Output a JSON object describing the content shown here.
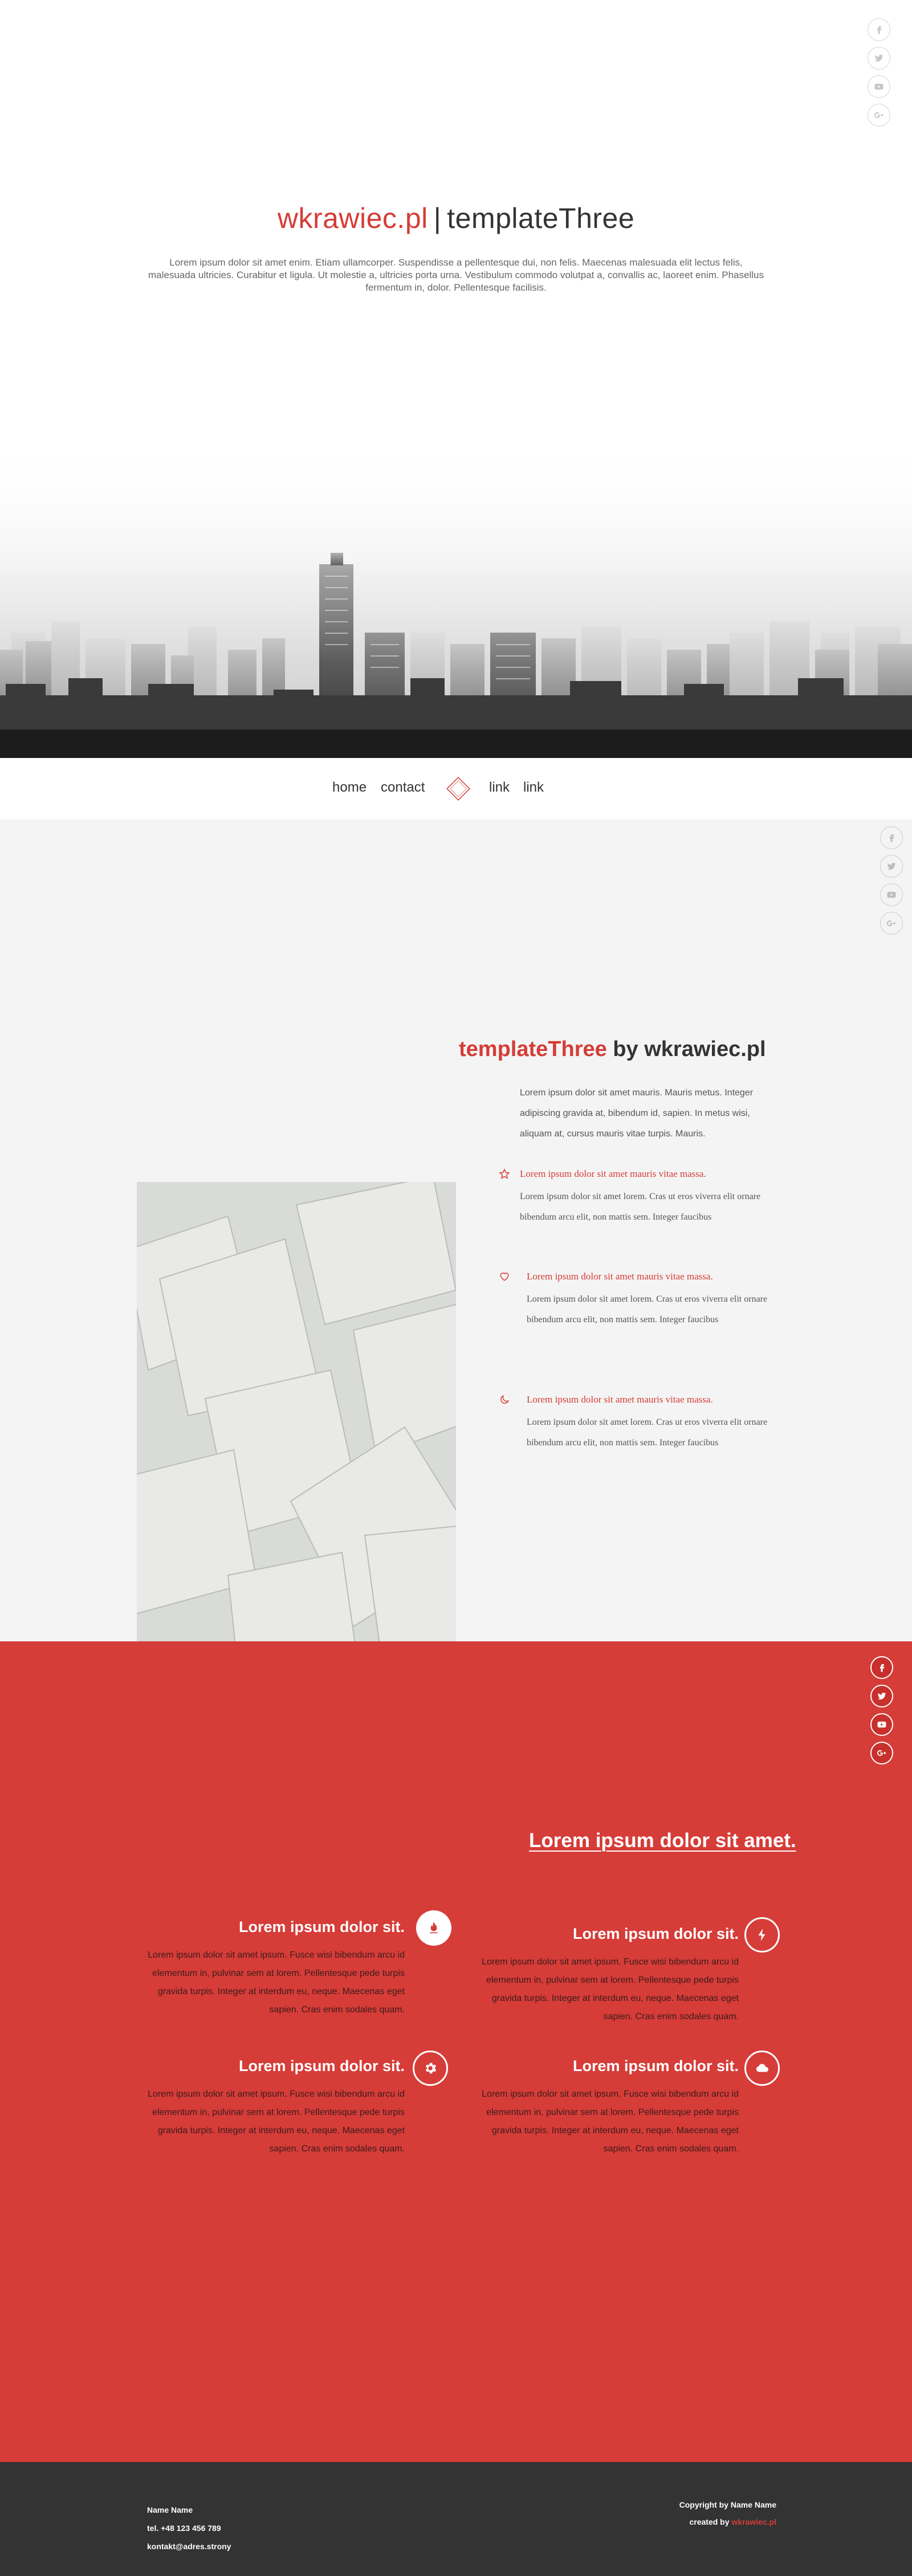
{
  "hero": {
    "brand": "wkrawiec.pl",
    "separator": "|",
    "template_name": "templateThree",
    "lead": "Lorem ipsum dolor sit amet enim. Etiam ullamcorper. Suspendisse a pellentesque dui, non felis. Maecenas malesuada elit lectus felis, malesuada ultricies. Curabitur et ligula. Ut molestie a, ultricies porta urna. Vestibulum commodo volutpat a, convallis ac, laoreet enim. Phasellus fermentum in, dolor. Pellentesque facilisis.",
    "social_icons": [
      "facebook-icon",
      "twitter-icon",
      "youtube-icon",
      "google-plus-icon"
    ]
  },
  "nav": {
    "items": [
      "home",
      "contact",
      "link",
      "link"
    ],
    "logo_icon": "diamond-logo-icon"
  },
  "about": {
    "heading_highlight": "templateThree",
    "heading_rest": " by wkrawiec.pl",
    "intro": "Lorem ipsum dolor sit amet mauris. Mauris metus. Integer adipiscing gravida at, bibendum id, sapien. In metus wisi, aliquam at, cursus mauris vitae turpis. Mauris.",
    "features": [
      {
        "icon": "star-icon",
        "title": "Lorem ipsum dolor sit amet mauris vitae massa.",
        "text": "Lorem ipsum dolor sit amet lorem. Cras ut eros viverra elit ornare bibendum arcu elit, non mattis sem. Integer faucibus"
      },
      {
        "icon": "heart-icon",
        "title": "Lorem ipsum dolor sit amet mauris vitae massa.",
        "text": "Lorem ipsum dolor sit amet lorem. Cras ut eros viverra elit ornare bibendum arcu elit, non mattis sem. Integer faucibus"
      },
      {
        "icon": "moon-icon",
        "title": "Lorem ipsum dolor sit amet mauris vitae massa.",
        "text": "Lorem ipsum dolor sit amet lorem. Cras ut eros viverra elit ornare bibendum arcu elit, non mattis sem. Integer faucibus"
      }
    ],
    "social_icons": [
      "facebook-icon",
      "twitter-icon",
      "youtube-icon",
      "google-plus-icon"
    ]
  },
  "services": {
    "title": "Lorem ipsum dolor sit amet.",
    "items": [
      {
        "icon": "fire-icon",
        "title": "Lorem ipsum dolor sit.",
        "text": "Lorem ipsum dolor sit amet ipsum. Fusce wisi bibendum arcu id elementum in, pulvinar sem at lorem. Pellentesque pede turpis gravida turpis. Integer at interdum eu, neque. Maecenas eget sapien. Cras enim sodales quam."
      },
      {
        "icon": "lightning-icon",
        "title": "Lorem ipsum dolor sit.",
        "text": "Lorem ipsum dolor sit amet ipsum. Fusce wisi bibendum arcu id elementum in, pulvinar sem at lorem. Pellentesque pede turpis gravida turpis. Integer at interdum eu, neque. Maecenas eget sapien. Cras enim sodales quam."
      },
      {
        "icon": "gear-icon",
        "title": "Lorem ipsum dolor sit.",
        "text": "Lorem ipsum dolor sit amet ipsum. Fusce wisi bibendum arcu id elementum in, pulvinar sem at lorem. Pellentesque pede turpis gravida turpis. Integer at interdum eu, neque. Maecenas eget sapien. Cras enim sodales quam."
      },
      {
        "icon": "cloud-icon",
        "title": "Lorem ipsum dolor sit.",
        "text": "Lorem ipsum dolor sit amet ipsum. Fusce wisi bibendum arcu id elementum in, pulvinar sem at lorem. Pellentesque pede turpis gravida turpis. Integer at interdum eu, neque. Maecenas eget sapien. Cras enim sodales quam."
      }
    ],
    "social_icons": [
      "facebook-icon",
      "twitter-icon",
      "youtube-icon",
      "google-plus-icon"
    ]
  },
  "footer": {
    "name": "Name Name",
    "phone": "tel. +48 123 456 789",
    "email": "kontakt@adres.strony",
    "copyright": "Copyright by Name Name",
    "created_by": "created by ",
    "creator": "wkrawiec.pl"
  },
  "colors": {
    "accent": "#d53c37",
    "services_bg": "#d63c38",
    "about_bg": "#f4f4f4",
    "footer_bg": "#333333"
  }
}
